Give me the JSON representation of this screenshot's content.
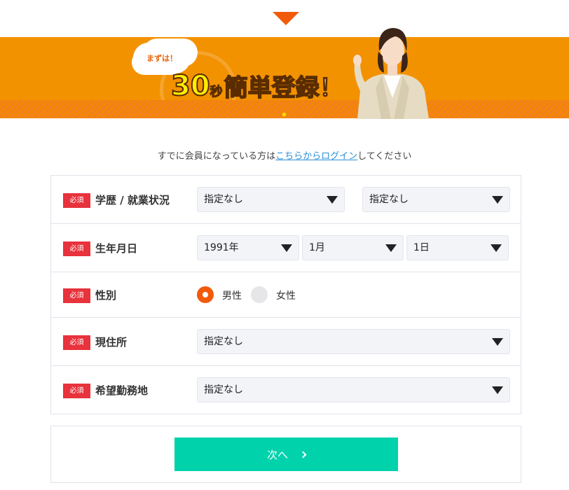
{
  "banner": {
    "cloud_text": "まずは！",
    "headline_number": "30",
    "headline_unit": "秒",
    "headline_text": "簡単登録！"
  },
  "login": {
    "prefix": "すでに会員になっている方は",
    "link": "こちらからログイン",
    "suffix": "してください"
  },
  "form": {
    "required_badge": "必須",
    "education": {
      "label": "学歴 / 就業状況",
      "select1": "指定なし",
      "select2": "指定なし"
    },
    "birthdate": {
      "label": "生年月日",
      "year": "1991年",
      "month": "1月",
      "day": "1日"
    },
    "gender": {
      "label": "性別",
      "options": [
        "男性",
        "女性"
      ],
      "selected": "男性"
    },
    "address": {
      "label": "現住所",
      "value": "指定なし"
    },
    "work_location": {
      "label": "希望勤務地",
      "value": "指定なし"
    }
  },
  "submit": {
    "label": "次へ"
  },
  "colors": {
    "accent_orange": "#f39200",
    "arrow_orange": "#f15a0b",
    "required_red": "#e8323c",
    "button_green": "#00d2ac",
    "link_blue": "#2b8fd6"
  },
  "icons": [
    "down-arrow-icon",
    "dropdown-triangle-icon",
    "chevron-right-icon"
  ]
}
